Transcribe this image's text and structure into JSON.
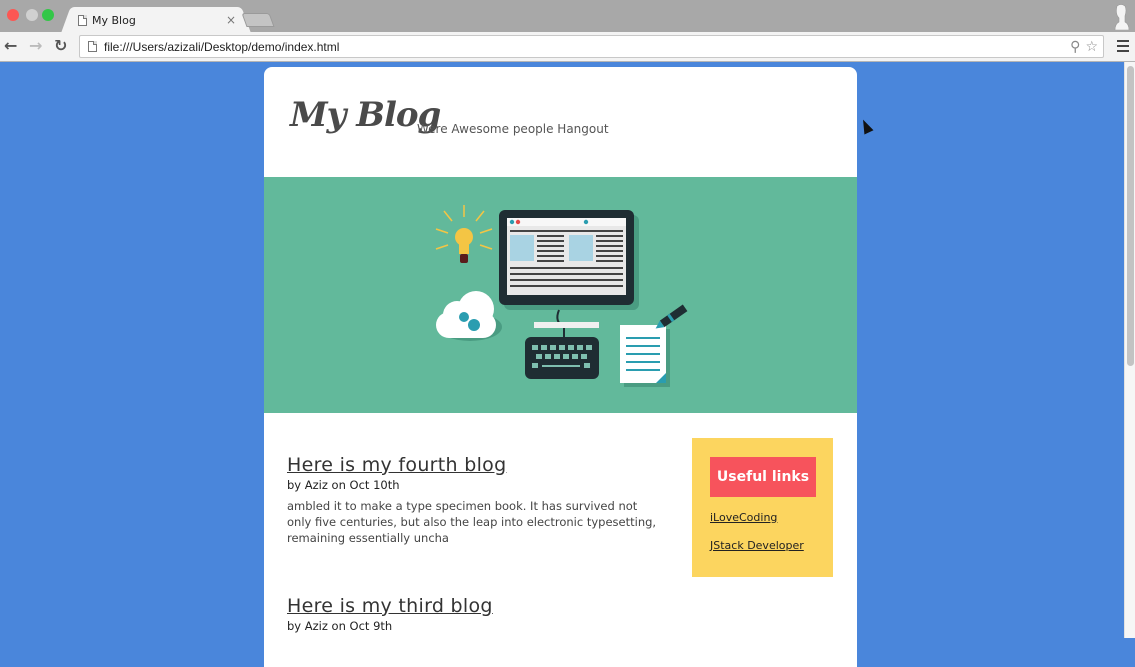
{
  "browser": {
    "tab_title": "My Blog",
    "tab_close": "×",
    "url": "file:///Users/azizali/Desktop/demo/index.html",
    "icons": {
      "back": "←",
      "forward": "→",
      "reload": "↻",
      "zoom": "⚲",
      "bookmark": "☆"
    }
  },
  "site": {
    "logo": "My Blog",
    "tagline": "Were Awesome people Hangout",
    "colors": {
      "page_background": "#4a86db",
      "hero": "#62b99b",
      "sidebar": "#fcd55f",
      "sidebar_button": "#f7535c"
    }
  },
  "posts": [
    {
      "title": "Here is my fourth blog",
      "meta": "by Aziz on Oct 10th",
      "excerpt": "ambled it to make a type specimen book. It has survived not only five centuries, but also the leap into electronic typesetting, remaining essentially uncha"
    },
    {
      "title": "Here is my third blog",
      "meta": "by Aziz on Oct 9th"
    }
  ],
  "sidebar": {
    "heading": "Useful links",
    "links": [
      "iLoveCoding",
      "JStack Developer"
    ]
  }
}
